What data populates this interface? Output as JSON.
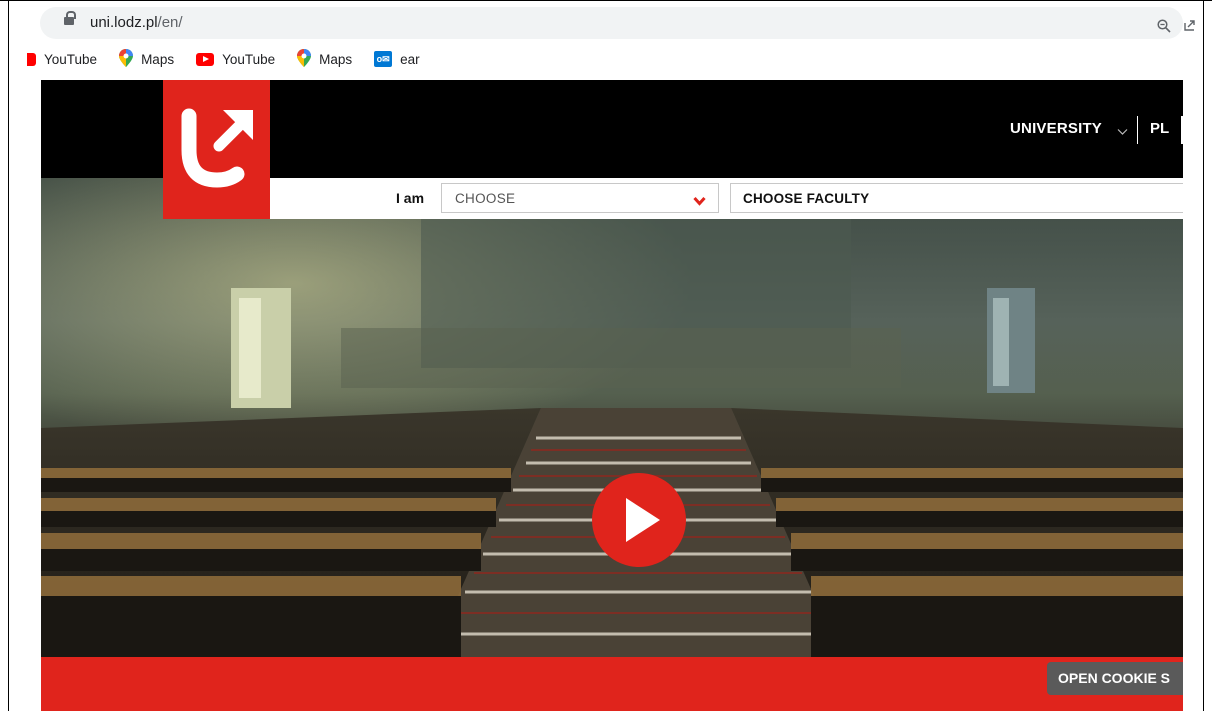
{
  "browser": {
    "url_domain": "uni.lodz.pl",
    "url_path": "/en/",
    "icons": [
      "lock-icon",
      "zoom-icon",
      "share-icon"
    ]
  },
  "bookmarks": [
    {
      "label": "YouTube",
      "icon": "youtube-icon"
    },
    {
      "label": "Maps",
      "icon": "maps-icon"
    },
    {
      "label": "YouTube",
      "icon": "youtube-icon"
    },
    {
      "label": "Maps",
      "icon": "maps-icon"
    },
    {
      "label": "ear",
      "icon": "outlook-icon"
    }
  ],
  "site": {
    "nav": {
      "university_label": "UNIVERSITY",
      "language_label": "PL"
    },
    "chooser": {
      "iam_label": "I am",
      "role_select_value": "CHOOSE",
      "faculty_select_value": "CHOOSE FACULTY"
    },
    "hero": {
      "play_icon": "play-icon"
    },
    "cookie_button_label": "OPEN COOKIE S"
  },
  "colors": {
    "brand_red": "#e0241c",
    "header_black": "#000000",
    "cookie_gray": "#5a5a5a"
  }
}
